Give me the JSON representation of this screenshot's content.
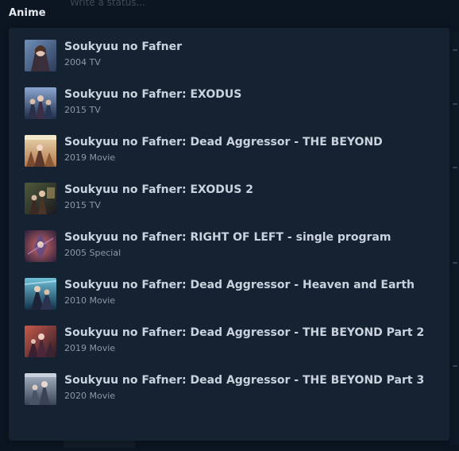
{
  "background": {
    "status_placeholder": "Write a status..."
  },
  "section": {
    "label": "Anime"
  },
  "colors": {
    "page_bg": "#0b1622",
    "panel_bg": "#152232",
    "title_text": "#c9d3de",
    "meta_text": "#8b98a7",
    "label_text": "#e6eaef"
  },
  "results": [
    {
      "title": "Soukyuu no Fafner",
      "meta": "2004 TV",
      "icon": "cover-art-thumbnail"
    },
    {
      "title": "Soukyuu no Fafner: EXODUS",
      "meta": "2015 TV",
      "icon": "cover-art-thumbnail"
    },
    {
      "title": "Soukyuu no Fafner: Dead Aggressor - THE BEYOND",
      "meta": "2019 Movie",
      "icon": "cover-art-thumbnail"
    },
    {
      "title": "Soukyuu no Fafner: EXODUS 2",
      "meta": "2015 TV",
      "icon": "cover-art-thumbnail"
    },
    {
      "title": "Soukyuu no Fafner: RIGHT OF LEFT - single program",
      "meta": "2005 Special",
      "icon": "cover-art-thumbnail"
    },
    {
      "title": "Soukyuu no Fafner: Dead Aggressor - Heaven and Earth",
      "meta": "2010 Movie",
      "icon": "cover-art-thumbnail"
    },
    {
      "title": "Soukyuu no Fafner: Dead Aggressor - THE BEYOND Part 2",
      "meta": "2019 Movie",
      "icon": "cover-art-thumbnail"
    },
    {
      "title": "Soukyuu no Fafner: Dead Aggressor - THE BEYOND Part 3",
      "meta": "2020 Movie",
      "icon": "cover-art-thumbnail"
    }
  ]
}
